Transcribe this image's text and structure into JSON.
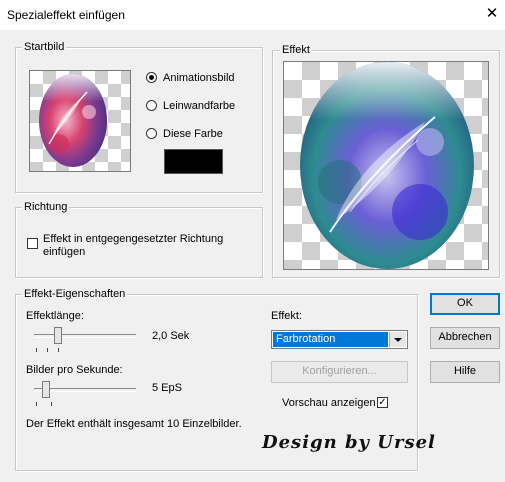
{
  "window": {
    "title": "Spezialeffekt einfügen",
    "close_glyph": "✕"
  },
  "startbild": {
    "label": "Startbild",
    "options": [
      {
        "label": "Animationsbild",
        "checked": true
      },
      {
        "label": "Leinwandfarbe",
        "checked": false
      },
      {
        "label": "Diese Farbe",
        "checked": false
      }
    ],
    "color_swatch": "#000000"
  },
  "richtung": {
    "label": "Richtung",
    "checkbox_label_line1": "Effekt in entgegengesetzter Richtung",
    "checkbox_label_line2": "einfügen",
    "checked": false
  },
  "effekt_preview": {
    "label": "Effekt"
  },
  "eigenschaften": {
    "label": "Effekt-Eigenschaften",
    "effektlaenge_label": "Effektlänge:",
    "effektlaenge_value": "2,0 Sek",
    "bilder_label": "Bilder pro Sekunde:",
    "bilder_value": "5 EpS",
    "info_text": "Der Effekt enthält insgesamt 10 Einzelbilder.",
    "effekt_select_label": "Effekt:",
    "effekt_select_value": "Farbrotation",
    "configure_button": "Konfigurieren...",
    "preview_checkbox_label": "Vorschau anzeigen",
    "preview_checked": true,
    "check_glyph": "✓"
  },
  "buttons": {
    "ok": "OK",
    "cancel": "Abbrechen",
    "help": "Hilfe"
  },
  "watermark": "Design by Ursel"
}
